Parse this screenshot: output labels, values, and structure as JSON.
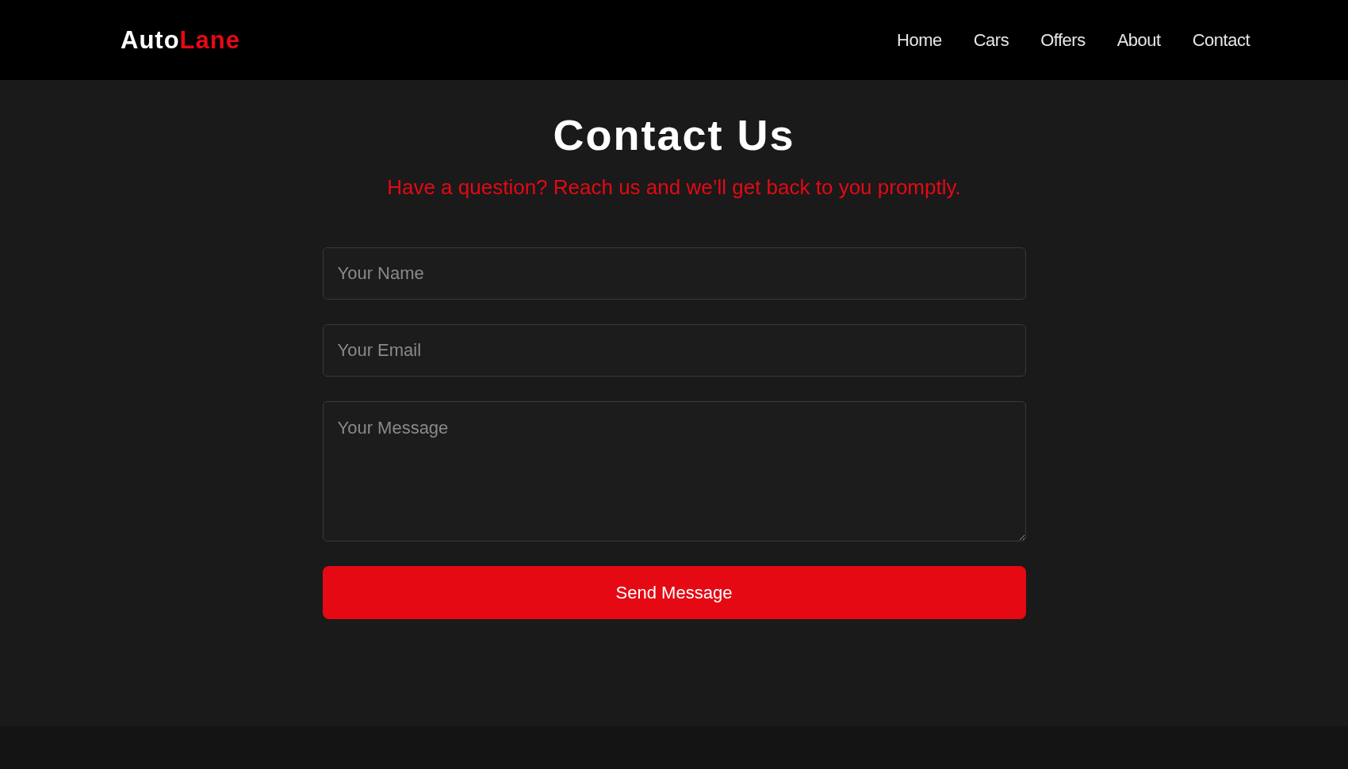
{
  "nav": {
    "logo": {
      "first": "Auto",
      "second": "Lane"
    },
    "links": [
      {
        "label": "Home"
      },
      {
        "label": "Cars"
      },
      {
        "label": "Offers"
      },
      {
        "label": "About"
      },
      {
        "label": "Contact"
      }
    ]
  },
  "contact": {
    "title": "Contact Us",
    "subtitle": "Have a question? Reach us and we’ll get back to you promptly.",
    "fields": [
      {
        "kind": "input",
        "placeholder": "Your Name"
      },
      {
        "kind": "input",
        "placeholder": "Your Email"
      },
      {
        "kind": "textarea",
        "placeholder": "Your Message"
      }
    ],
    "button": "Send Message"
  }
}
